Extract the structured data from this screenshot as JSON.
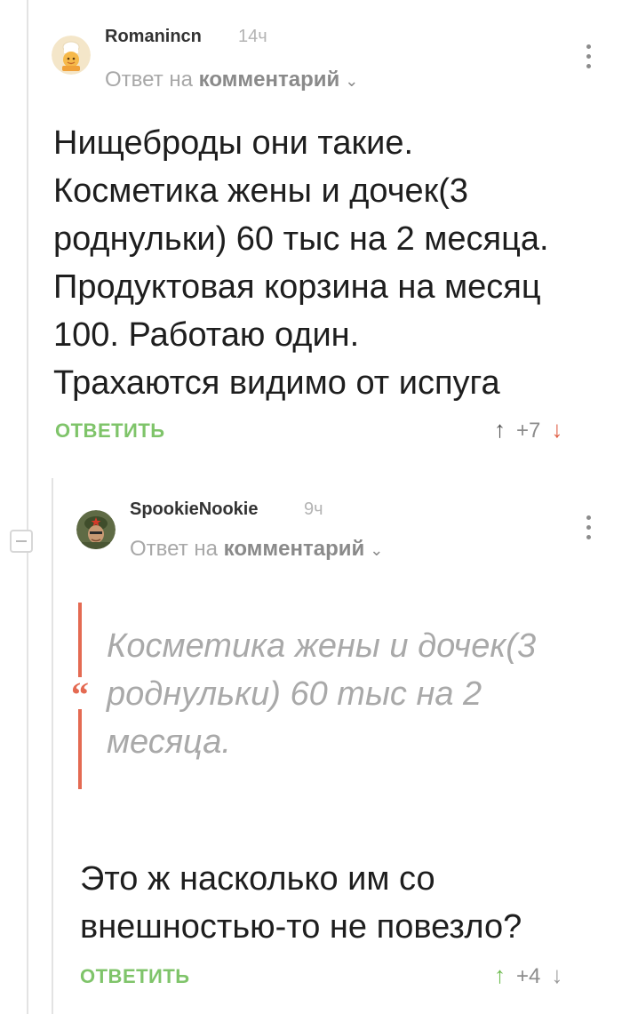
{
  "comment1": {
    "author": "Romanincn",
    "time": "14ч",
    "reply_prefix": "Ответ на",
    "reply_target": "комментарий",
    "body_lines": [
      "Нищеброды они такие.",
      "Косметика жены и дочек(3",
      "роднульки) 60 тыс на 2 месяца.",
      "Продуктовая корзина на месяц",
      "100. Работаю один.",
      "Трахаются видимо от испуга"
    ],
    "reply_label": "ОТВЕТИТЬ",
    "rating": "+7"
  },
  "comment2": {
    "author": "SpookieNookie",
    "time": "9ч",
    "reply_prefix": "Ответ на",
    "reply_target": "комментарий",
    "quote_lines": [
      "Косметика жены и дочек(3",
      "роднульки) 60 тыс на 2",
      "месяца."
    ],
    "body_lines": [
      "Это ж насколько им со",
      "внешностью-то не повезло?"
    ],
    "reply_label": "ОТВЕТИТЬ",
    "rating": "+4"
  },
  "icons": {
    "upvote": "↑",
    "downvote": "↓",
    "chevron": "⌄",
    "quote": "“"
  },
  "colors": {
    "accent_green": "#7fc46a",
    "downvote_red": "#e06046",
    "quote_red": "#e46a52"
  }
}
